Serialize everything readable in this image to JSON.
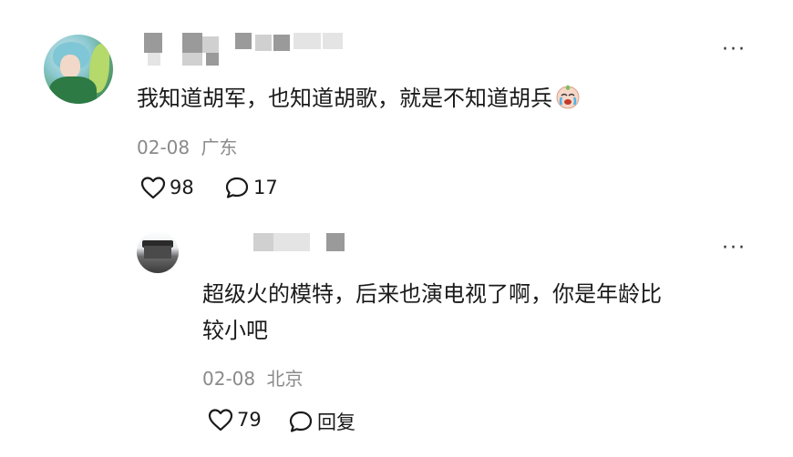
{
  "comment": {
    "text": "我知道胡军，也知道胡歌，就是不知道胡兵",
    "emoji_icon": "crying-face-icon",
    "date": "02-08",
    "location": "广东",
    "likes": "98",
    "replies": "17"
  },
  "reply": {
    "text_line1": "超级火的模特，后来也演电视了啊，你是年龄比",
    "text_line2": "较小吧",
    "date": "02-08",
    "location": "北京",
    "likes": "79",
    "reply_label": "回复"
  },
  "more_label": "···"
}
